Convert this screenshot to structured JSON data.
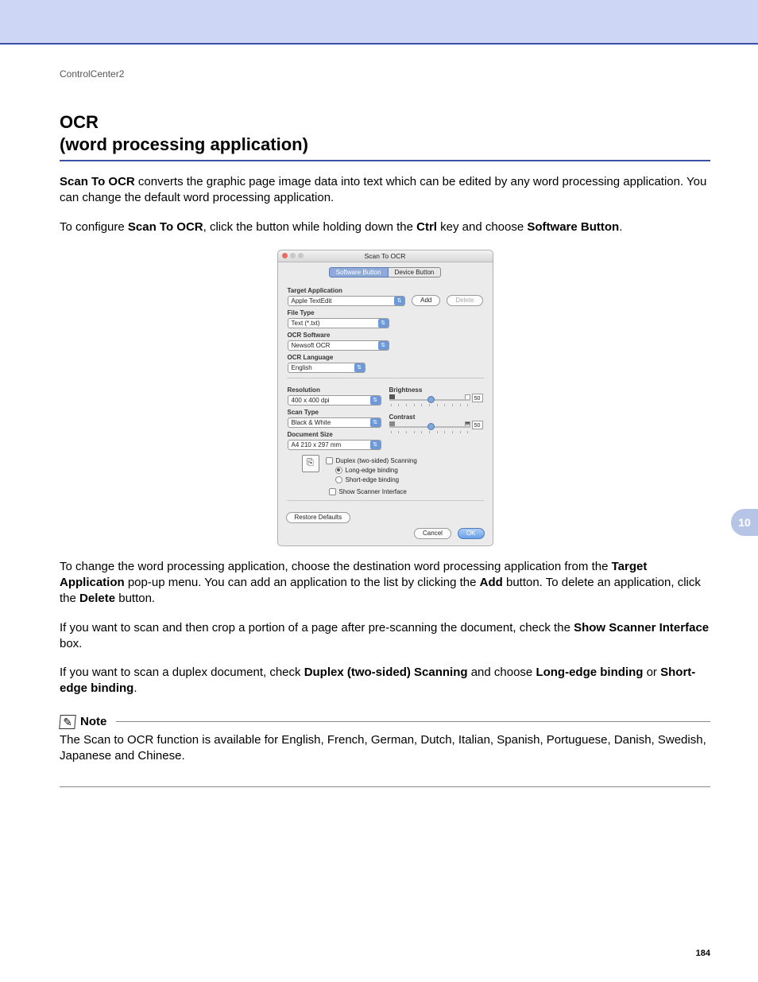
{
  "breadcrumb": "ControlCenter2",
  "title_line1": "OCR",
  "title_line2": "(word processing application)",
  "chapter_tab": "10",
  "page_number": "184",
  "p1": {
    "b1": "Scan To OCR",
    "t1": " converts the graphic page image data into text which can be edited by any word processing application. You can change the default word processing application."
  },
  "p2": {
    "t1": "To configure ",
    "b1": "Scan To OCR",
    "t2": ", click the button while holding down the ",
    "b2": "Ctrl",
    "t3": " key and choose ",
    "b3": "Software Button",
    "t4": "."
  },
  "dialog": {
    "title": "Scan To OCR",
    "tabs": {
      "software": "Software Button",
      "device": "Device Button"
    },
    "labels": {
      "target_app": "Target Application",
      "file_type": "File Type",
      "ocr_software": "OCR Software",
      "ocr_language": "OCR Language",
      "resolution": "Resolution",
      "scan_type": "Scan Type",
      "doc_size": "Document Size",
      "brightness": "Brightness",
      "contrast": "Contrast"
    },
    "values": {
      "target_app": "Apple TextEdit",
      "file_type": "Text (*.txt)",
      "ocr_software": "Newsoft OCR",
      "ocr_language": "English",
      "resolution": "400 x 400 dpi",
      "scan_type": "Black & White",
      "doc_size": "A4  210 x 297 mm",
      "brightness": "50",
      "contrast": "50"
    },
    "buttons": {
      "add": "Add",
      "delete": "Delete",
      "restore": "Restore Defaults",
      "cancel": "Cancel",
      "ok": "OK"
    },
    "checks": {
      "duplex": "Duplex (two-sided) Scanning",
      "long_edge": "Long-edge binding",
      "short_edge": "Short-edge binding",
      "show_scanner": "Show Scanner Interface"
    }
  },
  "p3": {
    "t1": "To change the word processing application, choose the destination word processing application from the ",
    "b1": "Target Application",
    "t2": " pop-up menu. You can add an application to the list by clicking the ",
    "b2": "Add",
    "t3": " button. To delete an application, click the ",
    "b3": "Delete",
    "t4": " button."
  },
  "p4": {
    "t1": "If you want to scan and then crop a portion of a page after pre-scanning the document, check the ",
    "b1": "Show Scanner Interface",
    "t2": " box."
  },
  "p5": {
    "t1": "If you want to scan a duplex document, check ",
    "b1": "Duplex (two-sided) Scanning",
    "t2": " and choose ",
    "b2": "Long-edge binding",
    "t3": " or ",
    "b3": "Short-edge binding",
    "t4": "."
  },
  "note": {
    "label": "Note",
    "text": "The Scan to OCR function is available for English, French, German, Dutch, Italian, Spanish, Portuguese, Danish, Swedish, Japanese and Chinese."
  }
}
